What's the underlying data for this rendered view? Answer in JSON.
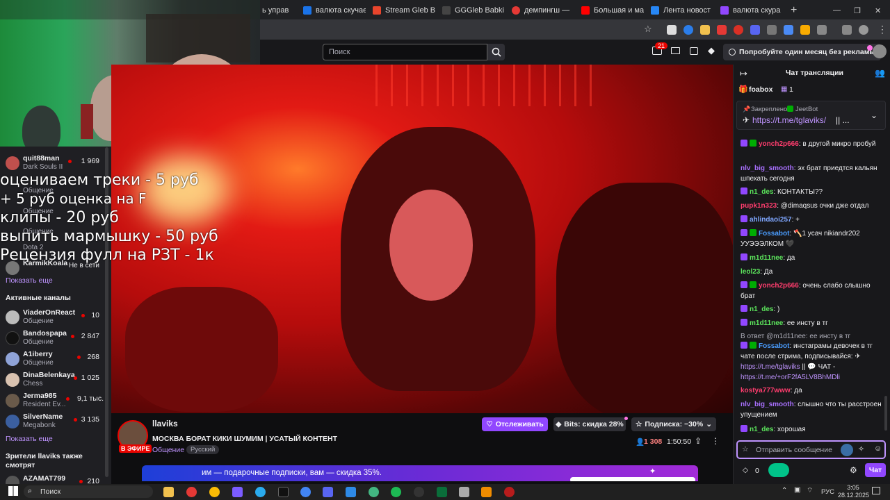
{
  "browser": {
    "tabs": [
      {
        "label": "ь управ"
      },
      {
        "label": "валюта скучае"
      },
      {
        "label": "Stream Gleb Bi"
      },
      {
        "label": "GGGleb Babki"
      },
      {
        "label": "демпингш — "
      },
      {
        "label": "Большая и ма"
      },
      {
        "label": "Лента новост"
      },
      {
        "label": "валюта скура"
      }
    ],
    "new_tab": "+"
  },
  "header": {
    "search_placeholder": "Поиск",
    "notif_count": "21",
    "promo": "Попробуйте один месяц без рекламы"
  },
  "overlay": {
    "lines": [
      {
        "text": "оцениваем треки - 5 руб"
      },
      {
        "text": "+ 5 руб оценка на F"
      },
      {
        "text": "клипы - 20 руб"
      },
      {
        "text": "выпить мармышку - 50 руб"
      },
      {
        "text": "Рецензия фулл на РЗТ - 1к"
      }
    ]
  },
  "sidebar": {
    "channels_top": [
      {
        "name": "quit88man",
        "game": "Dark Souls II",
        "viewers": "1 969"
      },
      {
        "name": "",
        "game": "Общение",
        "viewers": ""
      },
      {
        "name": "",
        "game": "Общение",
        "viewers": ""
      },
      {
        "name": "",
        "game": "Общение",
        "viewers": ""
      },
      {
        "name": "",
        "game": "Dota 2",
        "viewers": ""
      },
      {
        "name": "KarmikKoala",
        "game": "Не в сети",
        "viewers": ""
      }
    ],
    "show_more": "Показать еще",
    "active_title": "Активные каналы",
    "active": [
      {
        "name": "ViaderOnReact",
        "game": "Общение",
        "viewers": "10"
      },
      {
        "name": "Bandospapa",
        "game": "Общение",
        "viewers": "2 847"
      },
      {
        "name": "A1iberry",
        "game": "Общение",
        "viewers": "268"
      },
      {
        "name": "DinaBelenkaya",
        "game": "Chess",
        "viewers": "1 025"
      },
      {
        "name": "Jerma985",
        "game": "Resident Ev...",
        "viewers": "9,1 тыс."
      },
      {
        "name": "SilverName",
        "game": "Megabonk",
        "viewers": "3 135"
      }
    ],
    "show_more2": "Показать еще",
    "also_watch": "Зрители llaviks также смотрят",
    "also_first": {
      "name": "AZAMAT799",
      "viewers": "210"
    }
  },
  "stream": {
    "channel": "llaviks",
    "title": "МОСКВА БОРАТ КИКИ ШУМИМ | УСАТЫЙ КОНТЕНТ",
    "live": "В ЭФИРЕ",
    "category": "Общение",
    "tag": "Русский",
    "follow": "Отслеживать",
    "bits": "Bits: скидка 28%",
    "sub": "Подписка: −30%",
    "viewers": "1 308",
    "uptime": "1:50:50"
  },
  "banner": {
    "text": "им — подарочные подписки, вам — скидка 35%."
  },
  "chat": {
    "title": "Чат трансляции",
    "top_user": "foabox",
    "top_count": "1",
    "pinned_label": "Закреплено:",
    "pinned_by": "JeetBot",
    "pinned_link": "https://t.me/tglaviks/",
    "pinned_suffix": "|| ...",
    "messages": [
      {
        "user": "yonch2p666",
        "color": "#ff3d6e",
        "text": ": в другой микро пробуй"
      },
      {
        "user": "nlv_big_smooth",
        "color": "#a970ff",
        "text": ": эх брат приедтся кальян шпехать сегодня"
      },
      {
        "user": "n1_des",
        "color": "#5ce65c",
        "text": ": КОНТАКТЫ??"
      },
      {
        "user": "pupk1n323",
        "color": "#ff3d6e",
        "text": ": @dimaqsus очки дже отдал"
      },
      {
        "user": "ahlindaoi257",
        "color": "#7fa7ff",
        "text": ": +"
      },
      {
        "user": "Fossabot",
        "color": "#4a9dff",
        "text": ": 🪓1 усач nikiandr202 УУЭЭЭЛКОМ 🖤"
      },
      {
        "user": "m1d11nee",
        "color": "#5ce65c",
        "text": ": да"
      },
      {
        "user": "leol23",
        "color": "#5ce65c",
        "text": ": Да"
      },
      {
        "user": "yonch2p666",
        "color": "#ff3d6e",
        "text": ": очень слабо слышно брат"
      },
      {
        "user": "n1_des",
        "color": "#5ce65c",
        "text": ": )"
      },
      {
        "user": "m1d11nee",
        "color": "#5ce65c",
        "text": ": ее инсту в тг"
      },
      {
        "user": "Fossabot",
        "color": "#4a9dff",
        "text": ": инстаграмы девочек в тг чате после стрима, подписывайся: ✈"
      },
      {
        "user": "kostya777www",
        "color": "#ff3d6e",
        "text": ": да"
      },
      {
        "user": "nlv_big_smooth",
        "color": "#a970ff",
        "text": ": слышно что ты расстроен упущением"
      },
      {
        "user": "n1_des",
        "color": "#5ce65c",
        "text": ": хорошая"
      }
    ],
    "reply_note": "В ответ @m1d11nee: ее инсту в тг",
    "link1": "https://t.me/tglaviks",
    "link1_suffix": " || 💬 ЧАТ -",
    "link2": "https://t.me/+orF2fA5LV8BhMDli",
    "input_placeholder": "Отправить сообщение",
    "points": "0",
    "send": "Чат"
  },
  "taskbar": {
    "search": "Поиск",
    "lang": "РУС",
    "time": "3:05",
    "date": "28.12.2025"
  }
}
